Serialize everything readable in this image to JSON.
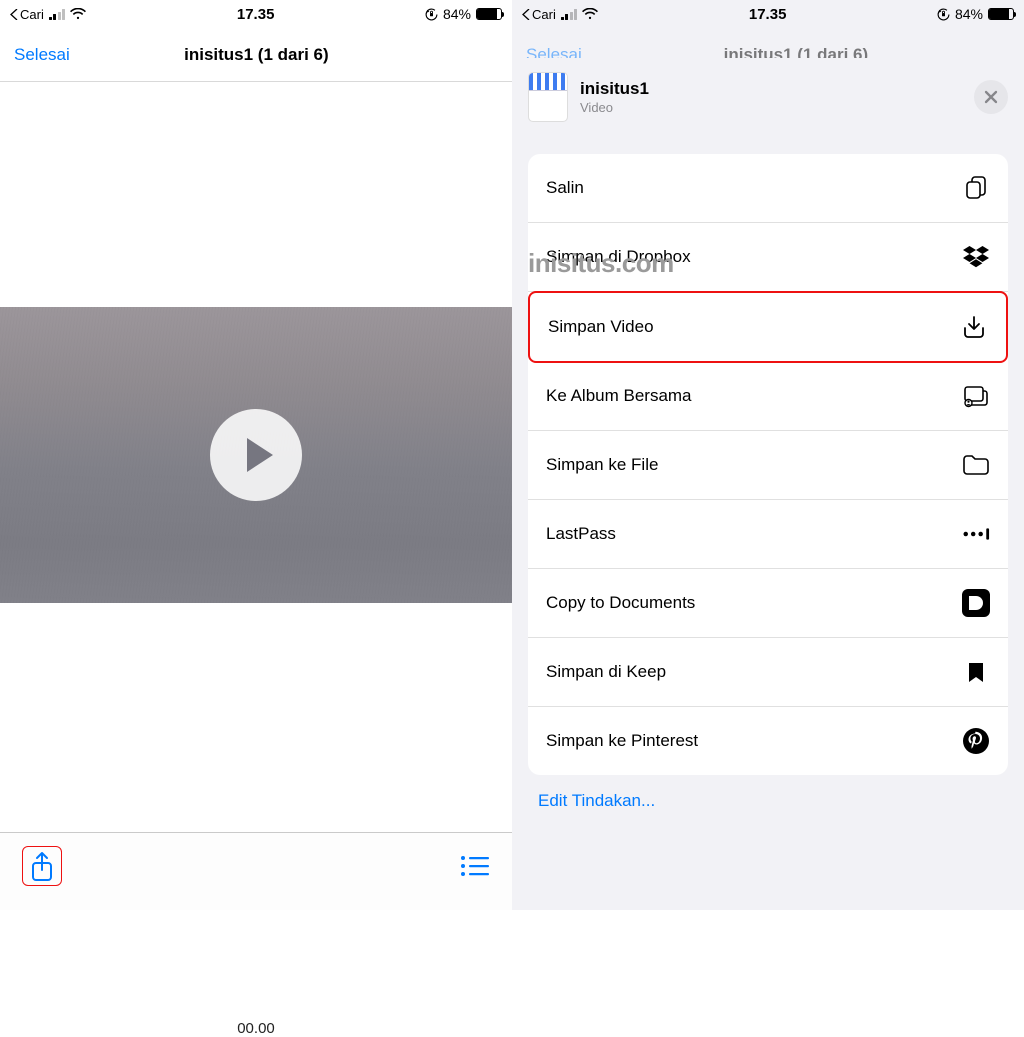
{
  "statusbar": {
    "back_label": "Cari",
    "time": "17.35",
    "battery_pct": "84%",
    "battery_fill_pct": 84
  },
  "left": {
    "nav": {
      "done": "Selesai",
      "title": "inisitus1 (1 dari 6)"
    },
    "video": {
      "duration": "00.00"
    }
  },
  "right": {
    "faded_nav": {
      "done": "Selesai",
      "title": "inisitus1 (1 dari 6)"
    },
    "sheet": {
      "title": "inisitus1",
      "subtitle": "Video",
      "actions": [
        {
          "label": "Salin",
          "icon": "copy-icon"
        },
        {
          "label": "Simpan di Dropbox",
          "icon": "dropbox-icon"
        },
        {
          "label": "Simpan Video",
          "icon": "save-download-icon",
          "highlight": true
        },
        {
          "label": "Ke Album Bersama",
          "icon": "shared-album-icon"
        },
        {
          "label": "Simpan ke File",
          "icon": "folder-icon"
        },
        {
          "label": "LastPass",
          "icon": "lastpass-icon"
        },
        {
          "label": "Copy to Documents",
          "icon": "documents-app-icon"
        },
        {
          "label": "Simpan di Keep",
          "icon": "bookmark-icon"
        },
        {
          "label": "Simpan ke Pinterest",
          "icon": "pinterest-icon"
        }
      ],
      "edit_label": "Edit Tindakan..."
    }
  },
  "watermark": "inisitus.com"
}
